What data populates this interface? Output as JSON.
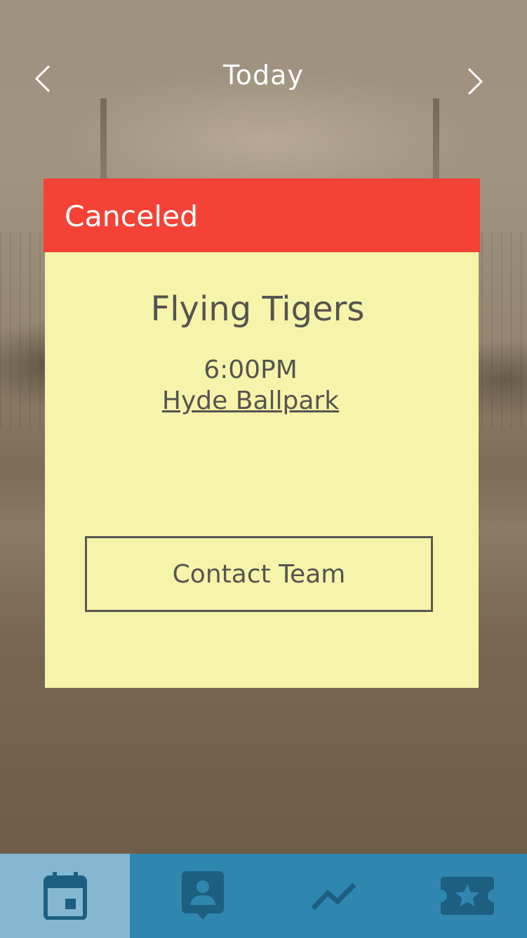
{
  "header": {
    "title": "Today",
    "prev_icon": "chevron-left-icon",
    "next_icon": "chevron-right-icon"
  },
  "game_card": {
    "status": "Canceled",
    "team_name": "Flying Tigers",
    "time": "6:00PM",
    "venue": "Hyde Ballpark",
    "contact_button_label": "Contact Team"
  },
  "colors": {
    "status_red": "#f44336",
    "card_yellow": "#f5f4aa",
    "tab_bar_blue": "#2f87af",
    "tab_active_blue": "#85b8d0",
    "icon_dark_blue": "#1d5f81"
  },
  "tabs": [
    {
      "icon": "calendar-icon",
      "active": true
    },
    {
      "icon": "profile-icon",
      "active": false
    },
    {
      "icon": "stats-icon",
      "active": false
    },
    {
      "icon": "ticket-icon",
      "active": false
    }
  ]
}
